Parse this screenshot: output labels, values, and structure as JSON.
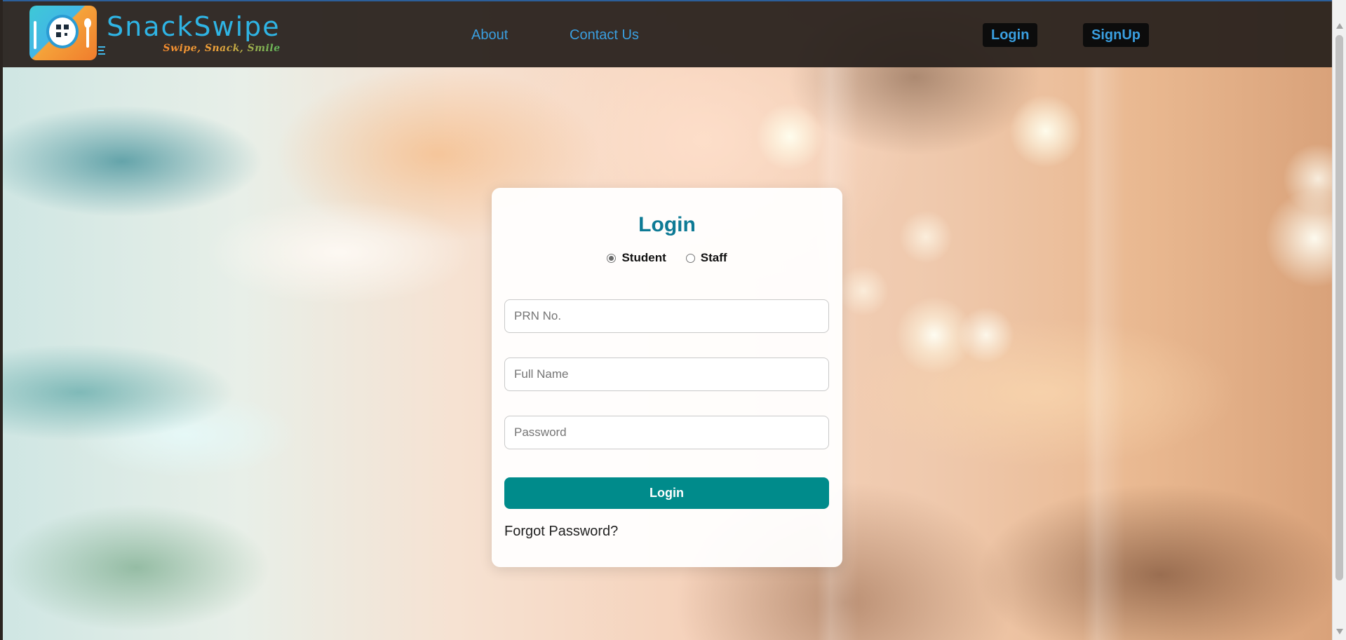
{
  "brand": {
    "name": "SnackSwipe",
    "tagline": "Swipe, Snack, Smile"
  },
  "nav": {
    "links": [
      {
        "label": "About"
      },
      {
        "label": "Contact Us"
      }
    ],
    "login_label": "Login",
    "signup_label": "SignUp"
  },
  "login_card": {
    "title": "Login",
    "roles": [
      {
        "label": "Student",
        "selected": true
      },
      {
        "label": "Staff",
        "selected": false
      }
    ],
    "fields": {
      "prn": {
        "placeholder": "PRN No.",
        "value": ""
      },
      "full_name": {
        "placeholder": "Full Name",
        "value": ""
      },
      "password": {
        "placeholder": "Password",
        "value": ""
      }
    },
    "submit_label": "Login",
    "forgot_label": "Forgot Password?"
  },
  "colors": {
    "accent": "#008b8b",
    "title": "#0d7a95",
    "nav_link": "#3a9fe0",
    "header_bg": "#28211d",
    "brand": "#2fb4e4"
  },
  "icons": {
    "logo": "snackswipe-logo-icon",
    "scroll_up": "scroll-up-arrow-icon",
    "scroll_down": "scroll-down-arrow-icon"
  }
}
